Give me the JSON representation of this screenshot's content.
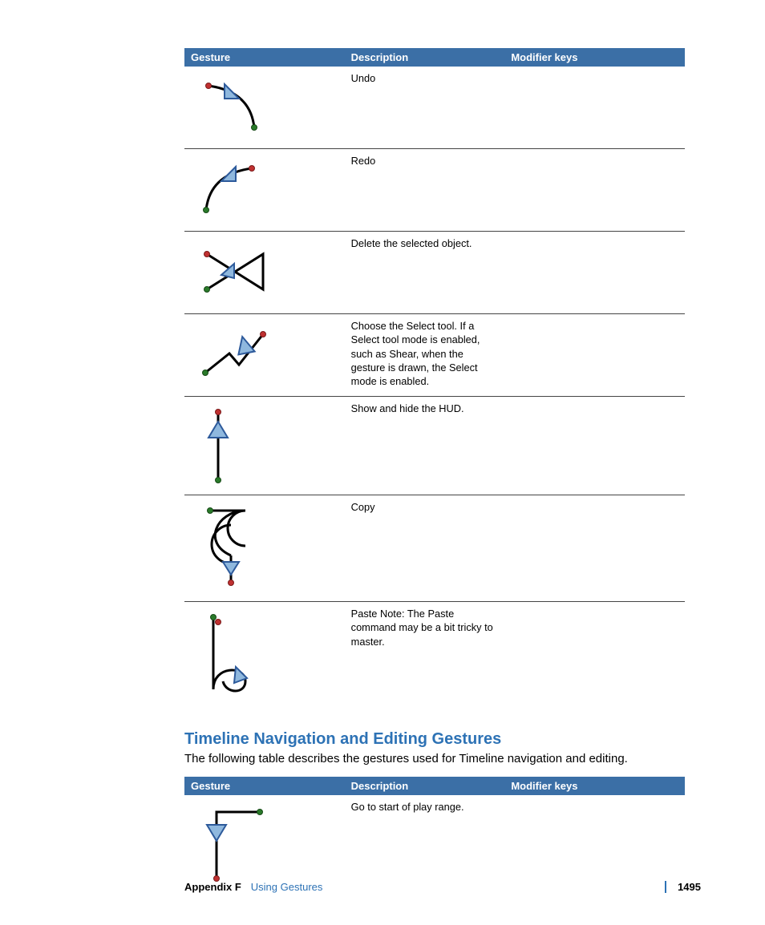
{
  "table1": {
    "headers": {
      "gesture": "Gesture",
      "description": "Description",
      "modifier": "Modifier keys"
    },
    "rows": [
      {
        "description": "Undo",
        "modifier": ""
      },
      {
        "description": "Redo",
        "modifier": ""
      },
      {
        "description": "Delete the selected object.",
        "modifier": ""
      },
      {
        "description": "Choose the Select tool. If a Select tool mode is enabled, such as Shear, when the gesture is drawn, the Select mode is enabled.",
        "modifier": ""
      },
      {
        "description": "Show and hide the HUD.",
        "modifier": ""
      },
      {
        "description": "Copy",
        "modifier": ""
      },
      {
        "description": "Paste Note: The Paste command may be a bit tricky to master.",
        "modifier": ""
      }
    ]
  },
  "section2": {
    "title": "Timeline Navigation and Editing Gestures",
    "description": "The following table describes the gestures used for Timeline navigation and editing."
  },
  "table2": {
    "headers": {
      "gesture": "Gesture",
      "description": "Description",
      "modifier": "Modifier keys"
    },
    "rows": [
      {
        "description": "Go to start of play range.",
        "modifier": ""
      }
    ]
  },
  "footer": {
    "appendix": "Appendix F",
    "chapter": "Using Gestures",
    "page": "1495"
  },
  "colors": {
    "header_bg": "#3b6fa6",
    "accent": "#2d72b5",
    "arrow_fill": "#8fb8de",
    "arrow_stroke": "#2d5a9b",
    "start_dot": "#c03030",
    "end_dot": "#2a7a2a"
  }
}
